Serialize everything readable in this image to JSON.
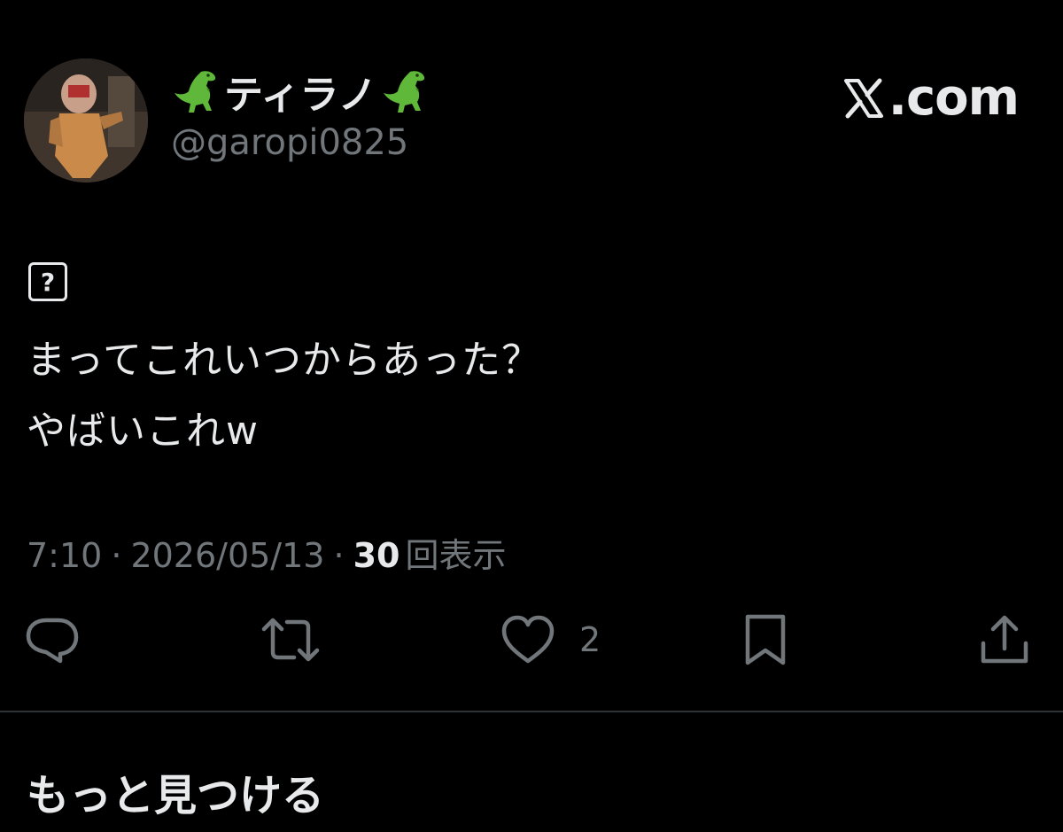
{
  "user": {
    "display_name": "ティラノ",
    "name_emoji": "t-rex-icon",
    "handle": "@garopi0825"
  },
  "brand": {
    "site_label": ".com",
    "logo_icon": "x-logo-icon"
  },
  "tweet": {
    "missing_glyph": "?",
    "lines": [
      "まってこれいつからあった？",
      "やばいこれw"
    ],
    "time": "7:10",
    "separator": "·",
    "date": "2026/05/13",
    "view_count": "30",
    "view_label": "回表示"
  },
  "actions": {
    "reply_icon": "reply-icon",
    "retweet_icon": "retweet-icon",
    "like_icon": "heart-icon",
    "like_count": "2",
    "bookmark_icon": "bookmark-icon",
    "share_icon": "share-icon"
  },
  "section": {
    "discover_title": "もっと見つける"
  },
  "colors": {
    "background": "#000000",
    "primary_text": "#e7e9ea",
    "secondary_text": "#71767b",
    "divider": "#2f3336"
  }
}
